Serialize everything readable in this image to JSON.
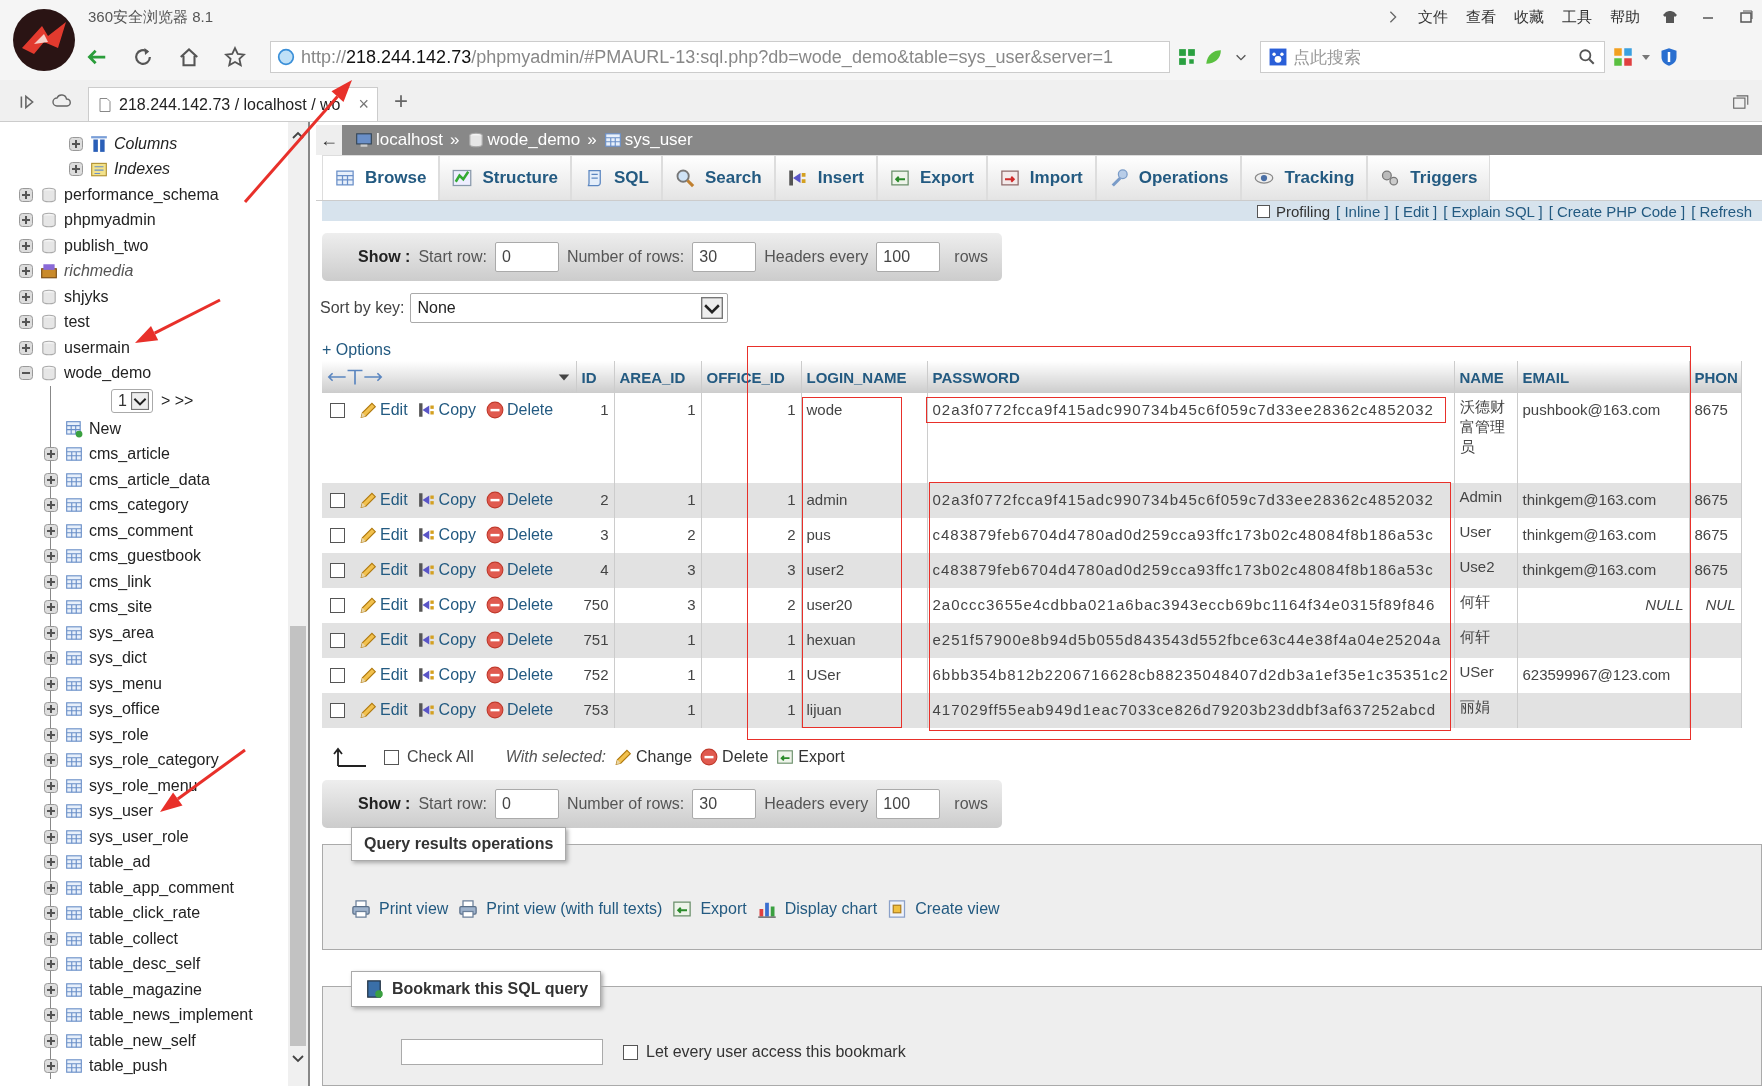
{
  "browser": {
    "title": "360安全浏览器 8.1",
    "menu": [
      "文件",
      "查看",
      "收藏",
      "工具",
      "帮助"
    ],
    "url": {
      "scheme": "http://",
      "host": "218.244.142.73",
      "path": "/phpmyadmin/#PMAURL-13:sql.php?db=wode_demo&table=sys_user&server=1"
    },
    "search": {
      "placeholder": "点此搜索"
    },
    "tabs": [
      {
        "label": "218.244.142.73 / localhost / wo",
        "close": "×",
        "selected": true
      }
    ],
    "new_tab": "+"
  },
  "sidebar": {
    "top_items": [
      {
        "label": "Columns",
        "kind": "columns"
      },
      {
        "label": "Indexes",
        "kind": "indexes"
      }
    ],
    "databases": [
      {
        "name": "performance_schema",
        "kind": "database",
        "expanded": false
      },
      {
        "name": "phpmyadmin",
        "kind": "database",
        "expanded": false
      },
      {
        "name": "publish_two",
        "kind": "database",
        "expanded": false
      },
      {
        "name": "richmedia",
        "kind": "group",
        "expanded": false
      },
      {
        "name": "shjyks",
        "kind": "database",
        "expanded": false
      },
      {
        "name": "test",
        "kind": "database",
        "expanded": false
      },
      {
        "name": "usermain",
        "kind": "database",
        "expanded": false
      },
      {
        "name": "wode_demo",
        "kind": "database",
        "expanded": true,
        "pager": {
          "page": "1",
          "links": "> >>"
        },
        "children": [
          {
            "name": "New",
            "kind": "new"
          },
          {
            "name": "cms_article",
            "kind": "table"
          },
          {
            "name": "cms_article_data",
            "kind": "table"
          },
          {
            "name": "cms_category",
            "kind": "table"
          },
          {
            "name": "cms_comment",
            "kind": "table"
          },
          {
            "name": "cms_guestbook",
            "kind": "table"
          },
          {
            "name": "cms_link",
            "kind": "table"
          },
          {
            "name": "cms_site",
            "kind": "table"
          },
          {
            "name": "sys_area",
            "kind": "table"
          },
          {
            "name": "sys_dict",
            "kind": "table"
          },
          {
            "name": "sys_menu",
            "kind": "table"
          },
          {
            "name": "sys_office",
            "kind": "table"
          },
          {
            "name": "sys_role",
            "kind": "table"
          },
          {
            "name": "sys_role_category",
            "kind": "table"
          },
          {
            "name": "sys_role_menu",
            "kind": "table"
          },
          {
            "name": "sys_user",
            "kind": "table"
          },
          {
            "name": "sys_user_role",
            "kind": "table"
          },
          {
            "name": "table_ad",
            "kind": "table"
          },
          {
            "name": "table_app_comment",
            "kind": "table"
          },
          {
            "name": "table_click_rate",
            "kind": "table"
          },
          {
            "name": "table_collect",
            "kind": "table"
          },
          {
            "name": "table_desc_self",
            "kind": "table"
          },
          {
            "name": "table_magazine",
            "kind": "table"
          },
          {
            "name": "table_news_implement",
            "kind": "table"
          },
          {
            "name": "table_new_self",
            "kind": "table"
          },
          {
            "name": "table_push",
            "kind": "table"
          }
        ]
      }
    ]
  },
  "breadcrumb": {
    "back": "←",
    "separator": "»",
    "items": [
      {
        "label": "localhost",
        "kind": "server"
      },
      {
        "label": "wode_demo",
        "kind": "database"
      },
      {
        "label": "sys_user",
        "kind": "table"
      }
    ]
  },
  "tabs": [
    {
      "label": "Browse",
      "selected": true
    },
    {
      "label": "Structure",
      "selected": false
    },
    {
      "label": "SQL",
      "selected": false
    },
    {
      "label": "Search",
      "selected": false
    },
    {
      "label": "Insert",
      "selected": false
    },
    {
      "label": "Export",
      "selected": false
    },
    {
      "label": "Import",
      "selected": false
    },
    {
      "label": "Operations",
      "selected": false
    },
    {
      "label": "Tracking",
      "selected": false
    },
    {
      "label": "Triggers",
      "selected": false
    }
  ],
  "profiling": {
    "label": "Profiling",
    "checked": false,
    "links": [
      "[ Inline ]",
      "[ Edit ]",
      "[ Explain SQL ]",
      "[ Create PHP Code ]",
      "[ Refresh"
    ]
  },
  "show_bar_top": {
    "show": "Show :",
    "start_label": "Start row:",
    "start": "0",
    "rows_label": "Number of rows:",
    "rows": "30",
    "headers_label": "Headers every",
    "headers": "100",
    "suffix": "rows"
  },
  "sort": {
    "label": "Sort by key:",
    "value": "None"
  },
  "options": "+ Options",
  "results": {
    "columns": [
      "ID",
      "AREA_ID",
      "OFFICE_ID",
      "LOGIN_NAME",
      "PASSWORD",
      "NAME",
      "EMAIL",
      "PHON"
    ],
    "rows": [
      {
        "checked": false,
        "actions": [
          "Edit",
          "Copy",
          "Delete"
        ],
        "cells": [
          "1",
          "1",
          "1",
          "wode",
          "02a3f0772fcca9f415adc990734b45c6f059c7d33ee28362c4852032",
          "沃德财富管理员",
          "pushbook@163.com",
          "8675"
        ]
      },
      {
        "checked": false,
        "actions": [
          "Edit",
          "Copy",
          "Delete"
        ],
        "cells": [
          "2",
          "1",
          "1",
          "admin",
          "02a3f0772fcca9f415adc990734b45c6f059c7d33ee28362c4852032",
          "Admin",
          "thinkgem@163.com",
          "8675"
        ]
      },
      {
        "checked": false,
        "actions": [
          "Edit",
          "Copy",
          "Delete"
        ],
        "cells": [
          "3",
          "2",
          "2",
          "pus",
          "c483879feb6704d4780ad0d259cca93ffc173b02c48084f8b186a53c",
          "User",
          "thinkgem@163.com",
          "8675"
        ]
      },
      {
        "checked": false,
        "actions": [
          "Edit",
          "Copy",
          "Delete"
        ],
        "cells": [
          "4",
          "3",
          "3",
          "user2",
          "c483879feb6704d4780ad0d259cca93ffc173b02c48084f8b186a53c",
          "Use2",
          "thinkgem@163.com",
          "8675"
        ]
      },
      {
        "checked": false,
        "actions": [
          "Edit",
          "Copy",
          "Delete"
        ],
        "cells": [
          "750",
          "3",
          "2",
          "user20",
          "2a0ccc3655e4cdbba021a6bac3943eccb69bc1164f34e0315f89f846",
          "何轩",
          "NULL",
          "NUL"
        ],
        "email_null": true,
        "phone_null": true
      },
      {
        "checked": false,
        "actions": [
          "Edit",
          "Copy",
          "Delete"
        ],
        "cells": [
          "751",
          "1",
          "1",
          "hexuan",
          "e251f57900e8b94d5b055d843543d552fbce63c44e38f4a04e25204a",
          "何轩",
          null,
          null
        ]
      },
      {
        "checked": false,
        "actions": [
          "Edit",
          "Copy",
          "Delete"
        ],
        "cells": [
          "752",
          "1",
          "1",
          "USer",
          "6bbb354b812b2206716628cb88235048407d2db3a1ef35e1c35351c2",
          "USer",
          "623599967@123.com",
          null
        ]
      },
      {
        "checked": false,
        "actions": [
          "Edit",
          "Copy",
          "Delete"
        ],
        "cells": [
          "753",
          "1",
          "1",
          "lijuan",
          "417029ff55eab949d1eac7033ce826d79203b23ddbf3af637252abcd",
          "丽娟",
          null,
          null
        ]
      }
    ]
  },
  "with_selected": {
    "check_all": "Check All",
    "checked": false,
    "label": "With selected:",
    "actions": [
      "Change",
      "Delete",
      "Export"
    ]
  },
  "show_bar_bottom": {
    "show": "Show :",
    "start_label": "Start row:",
    "start": "0",
    "rows_label": "Number of rows:",
    "rows": "30",
    "headers_label": "Headers every",
    "headers": "100",
    "suffix": "rows"
  },
  "query_ops": {
    "legend": "Query results operations",
    "links": [
      "Print view",
      "Print view (with full texts)",
      "Export",
      "Display chart",
      "Create view"
    ]
  },
  "bookmark": {
    "legend": "Bookmark this SQL query",
    "share_label": "Let every user access this bookmark",
    "share_checked": false
  }
}
